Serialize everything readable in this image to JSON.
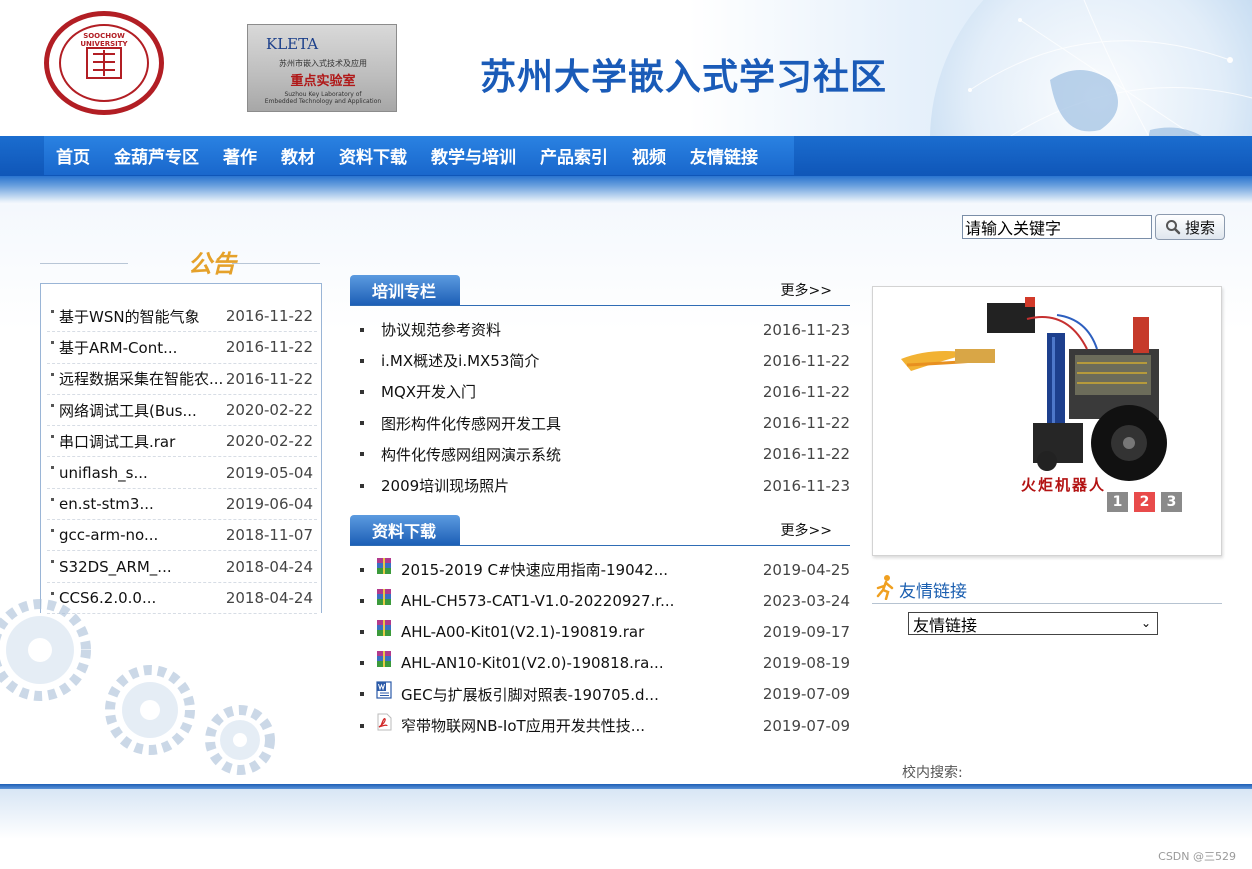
{
  "header": {
    "site_title": "苏州大学嵌入式学习社区",
    "seal_mono": "SOOCHOW UNIVERSITY",
    "kleta": {
      "brand": "KLETA",
      "line1": "苏州市嵌入式技术及应用",
      "line2": "重点实验室",
      "line3a": "Suzhou Key Laboratory of",
      "line3b": "Embedded Technology and Application"
    }
  },
  "nav": {
    "items": [
      {
        "label": "首页"
      },
      {
        "label": "金葫芦专区"
      },
      {
        "label": "著作"
      },
      {
        "label": "教材"
      },
      {
        "label": "资料下载"
      },
      {
        "label": "教学与培训"
      },
      {
        "label": "产品索引"
      },
      {
        "label": "视频"
      },
      {
        "label": "友情链接"
      }
    ]
  },
  "search": {
    "value": "请输入关键字",
    "button_label": "搜索"
  },
  "notice": {
    "title": "公告",
    "items": [
      {
        "title": "基于WSN的智能气象",
        "date": "2016-11-22"
      },
      {
        "title": "基于ARM-Cont...",
        "date": "2016-11-22"
      },
      {
        "title": "远程数据采集在智能农...",
        "date": "2016-11-22"
      },
      {
        "title": "网络调试工具(Bus...",
        "date": "2020-02-22"
      },
      {
        "title": "串口调试工具.rar",
        "date": "2020-02-22"
      },
      {
        "title": "uniflash_s...",
        "date": "2019-05-04"
      },
      {
        "title": "en.st-stm3...",
        "date": "2019-06-04"
      },
      {
        "title": "gcc-arm-no...",
        "date": "2018-11-07"
      },
      {
        "title": "S32DS_ARM_...",
        "date": "2018-04-24"
      },
      {
        "title": "CCS6.2.0.0...",
        "date": "2018-04-24"
      }
    ]
  },
  "training": {
    "title": "培训专栏",
    "more": "更多>>",
    "items": [
      {
        "title": "协议规范参考资料",
        "date": "2016-11-23"
      },
      {
        "title": "i.MX概述及i.MX53简介",
        "date": "2016-11-22"
      },
      {
        "title": "MQX开发入门",
        "date": "2016-11-22"
      },
      {
        "title": "图形构件化传感网开发工具",
        "date": "2016-11-22"
      },
      {
        "title": "构件化传感网组网演示系统",
        "date": "2016-11-22"
      },
      {
        "title": "2009培训现场照片",
        "date": "2016-11-23"
      }
    ]
  },
  "downloads": {
    "title": "资料下载",
    "more": "更多>>",
    "items": [
      {
        "title": "2015-2019 C#快速应用指南-19042...",
        "date": "2019-04-25",
        "icon": "rar-archive-icon"
      },
      {
        "title": "AHL-CH573-CAT1-V1.0-20220927.r...",
        "date": "2023-03-24",
        "icon": "rar-archive-icon"
      },
      {
        "title": "AHL-A00-Kit01(V2.1)-190819.rar",
        "date": "2019-09-17",
        "icon": "rar-archive-icon"
      },
      {
        "title": "AHL-AN10-Kit01(V2.0)-190818.ra...",
        "date": "2019-08-19",
        "icon": "rar-archive-icon"
      },
      {
        "title": "GEC与扩展板引脚对照表-190705.d...",
        "date": "2019-07-09",
        "icon": "word-doc-icon"
      },
      {
        "title": "窄带物联网NB-IoT应用开发共性技...",
        "date": "2019-07-09",
        "icon": "pdf-file-icon"
      }
    ]
  },
  "slider": {
    "caption": "火炬机器人",
    "pages": [
      "1",
      "2",
      "3"
    ],
    "active_page": "2"
  },
  "links": {
    "title": "友情链接",
    "select_value": "友情链接"
  },
  "site_search_label": "校内搜索:",
  "watermark": "CSDN @三529",
  "colors": {
    "brand_blue": "#1a5bb8",
    "nav_blue": "#1967cc",
    "seal_red": "#b21e24",
    "pager_active": "#e84b4b"
  }
}
